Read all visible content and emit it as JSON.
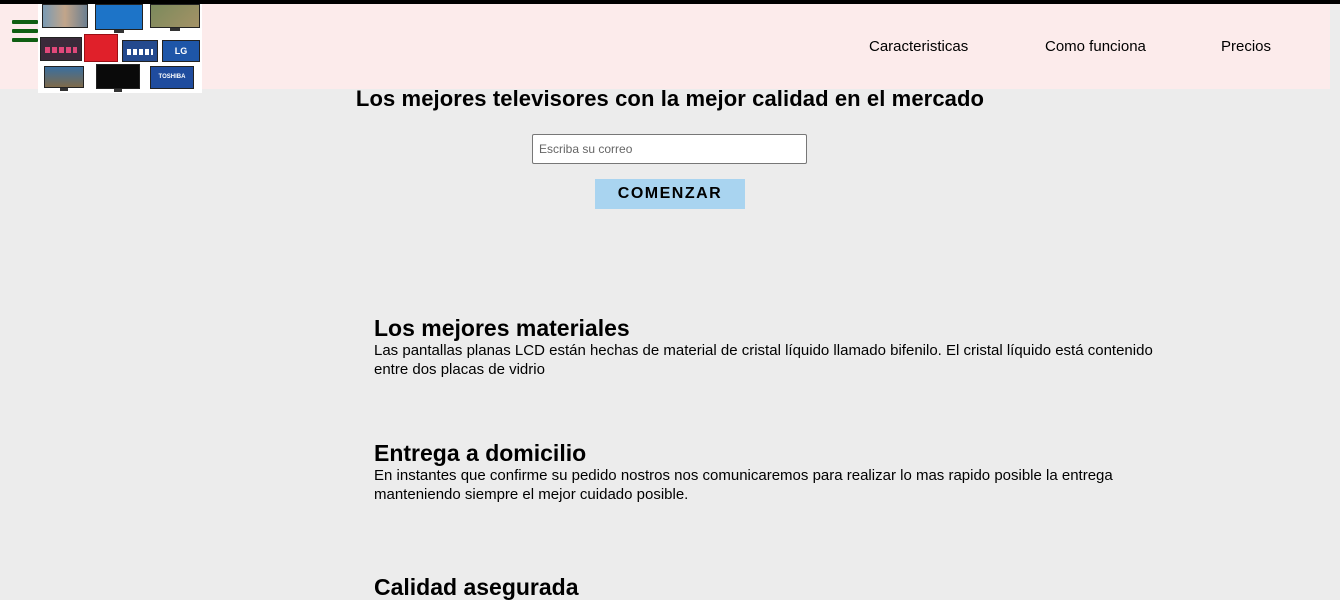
{
  "header": {
    "nav": [
      {
        "label": "Caracteristicas"
      },
      {
        "label": "Como funciona"
      },
      {
        "label": "Precios"
      }
    ]
  },
  "logo": {
    "brands": [
      "LG",
      "TOSHIBA"
    ]
  },
  "hero": {
    "title": "Los mejores televisores con la mejor calidad en el mercado",
    "email_placeholder": "Escriba su correo",
    "button_label": "COMENZAR"
  },
  "features": [
    {
      "title": "Los mejores materiales",
      "text": "Las pantallas planas LCD están hechas de material de cristal líquido llamado bifenilo. El cristal líquido está contenido entre dos placas de vidrio"
    },
    {
      "title": "Entrega a domicilio",
      "text": "En instantes que confirme su pedido nostros nos comunicaremos para realizar lo mas rapido posible la entrega manteniendo siempre el mejor cuidado posible."
    },
    {
      "title": "Calidad asegurada",
      "text": ""
    }
  ],
  "colors": {
    "header_bg": "#fcebeb",
    "page_bg": "#ececec",
    "button_bg": "#a9d4f0",
    "hamburger": "#0f5e12"
  }
}
